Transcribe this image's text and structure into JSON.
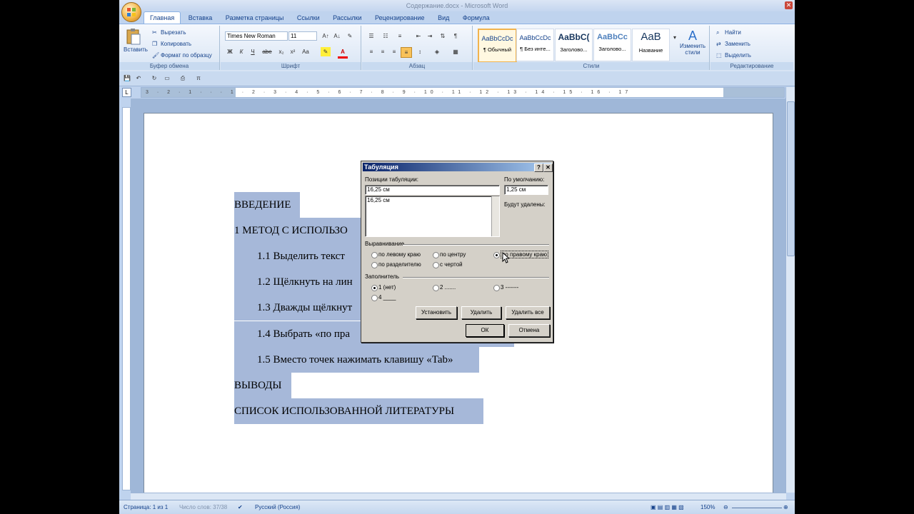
{
  "window": {
    "title": "Содержание.docx - Microsoft Word"
  },
  "ribbon_tabs": [
    "Главная",
    "Вставка",
    "Разметка страницы",
    "Ссылки",
    "Рассылки",
    "Рецензирование",
    "Вид",
    "Формула"
  ],
  "clipboard": {
    "paste": "Вставить",
    "cut": "Вырезать",
    "copy": "Копировать",
    "format_painter": "Формат по образцу",
    "group": "Буфер обмена"
  },
  "font": {
    "name": "Times New Roman",
    "size": "11",
    "group": "Шрифт",
    "btns": [
      "Ж",
      "К",
      "Ч",
      "abe",
      "x₂",
      "x²",
      "Aa",
      "A"
    ]
  },
  "paragraph": {
    "group": "Абзац"
  },
  "styles": {
    "group": "Стили",
    "change_label": "Изменить стили",
    "items": [
      {
        "preview": "AaBbCcDc",
        "name": "¶ Обычный"
      },
      {
        "preview": "AaBbCcDc",
        "name": "¶ Без инте..."
      },
      {
        "preview": "AaBbC(",
        "name": "Заголово..."
      },
      {
        "preview": "AaBbCc",
        "name": "Заголово..."
      },
      {
        "preview": "AaB",
        "name": "Название"
      }
    ]
  },
  "editing": {
    "group": "Редактирование",
    "find": "Найти",
    "replace": "Заменить",
    "select": "Выделить"
  },
  "ruler_nums": "3 · 2 · 1 · · · 1 · 2 · 3 · 4 · 5 · 6 · 7 · 8 · 9 · 10 · 11 · 12 · 13 · 14 · 15 · 16 · 17",
  "document_lines": [
    "ВВЕДЕНИЕ",
    "1 МЕТОД С ИСПОЛЬЗО",
    "1.1 Выделить текст",
    "1.2 Щёлкнуть на лин",
    "1.3 Дважды щёлкнут",
    "1.4 Выбрать «по пра",
    "1.5 Вместо точек нажимать клавишу «Tab»",
    "ВЫВОДЫ",
    "СПИСОК ИСПОЛЬЗОВАННОЙ ЛИТЕРАТУРЫ"
  ],
  "dialog": {
    "title": "Табуляция",
    "help": "?",
    "close": "✕",
    "positions_label": "Позиции табуляции:",
    "position_value": "16,25 см",
    "list_items": [
      "16,25 см"
    ],
    "default_label": "По умолчанию:",
    "default_value": "1,25 см",
    "will_clear_label": "Будут удалены:",
    "alignment_label": "Выравнивание",
    "alignment_options": [
      "по левому краю",
      "по центру",
      "по правому краю",
      "по разделителю",
      "с чертой"
    ],
    "alignment_selected": "по правому краю",
    "leader_label": "Заполнитель",
    "leader_options": [
      "1 (нет)",
      "2 .......",
      "3 -------",
      "4 ____"
    ],
    "leader_selected": "1 (нет)",
    "btn_set": "Установить",
    "btn_clear": "Удалить",
    "btn_clear_all": "Удалить все",
    "btn_ok": "ОК",
    "btn_cancel": "Отмена"
  },
  "statusbar": {
    "page": "Страница: 1 из 1",
    "words": "Число слов: 37/38",
    "lang": "Русский (Россия)",
    "zoom": "150%"
  },
  "colors": {
    "selection": "#a6b8d9",
    "ribbon_text": "#15428b",
    "dialog_title": "#0a246a"
  }
}
